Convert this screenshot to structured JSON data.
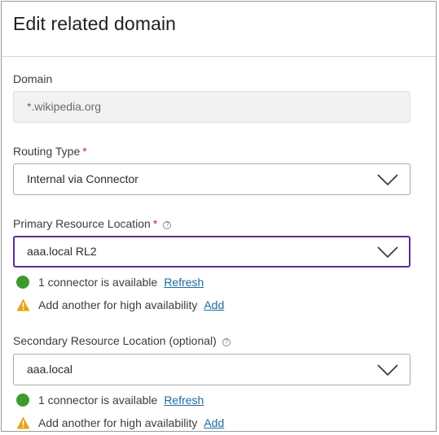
{
  "dialog": {
    "title": "Edit related domain"
  },
  "domain": {
    "label": "Domain",
    "value": "*.wikipedia.org"
  },
  "routing_type": {
    "label": "Routing Type",
    "required_mark": "*",
    "value": "Internal via Connector"
  },
  "primary_location": {
    "label": "Primary Resource Location",
    "required_mark": "*",
    "help_glyph": "?",
    "value": "aaa.local RL2",
    "status": {
      "text": "1 connector is available",
      "link": "Refresh"
    },
    "warning": {
      "text": "Add another for high availability",
      "link": "Add"
    }
  },
  "secondary_location": {
    "label": "Secondary Resource Location (optional)",
    "help_glyph": "?",
    "value": "aaa.local",
    "status": {
      "text": "1 connector is available",
      "link": "Refresh"
    },
    "warning": {
      "text": "Add another for high availability",
      "link": "Add"
    }
  },
  "colors": {
    "accent": "#5b2d90",
    "required": "#c4242b",
    "success": "#3f9a2e",
    "warning": "#e8a317",
    "link": "#1a6b9e"
  },
  "icons": {
    "chevron": "chevron-down-icon",
    "help": "help-circle-icon",
    "ok": "status-ok-icon",
    "warning": "warning-icon"
  }
}
